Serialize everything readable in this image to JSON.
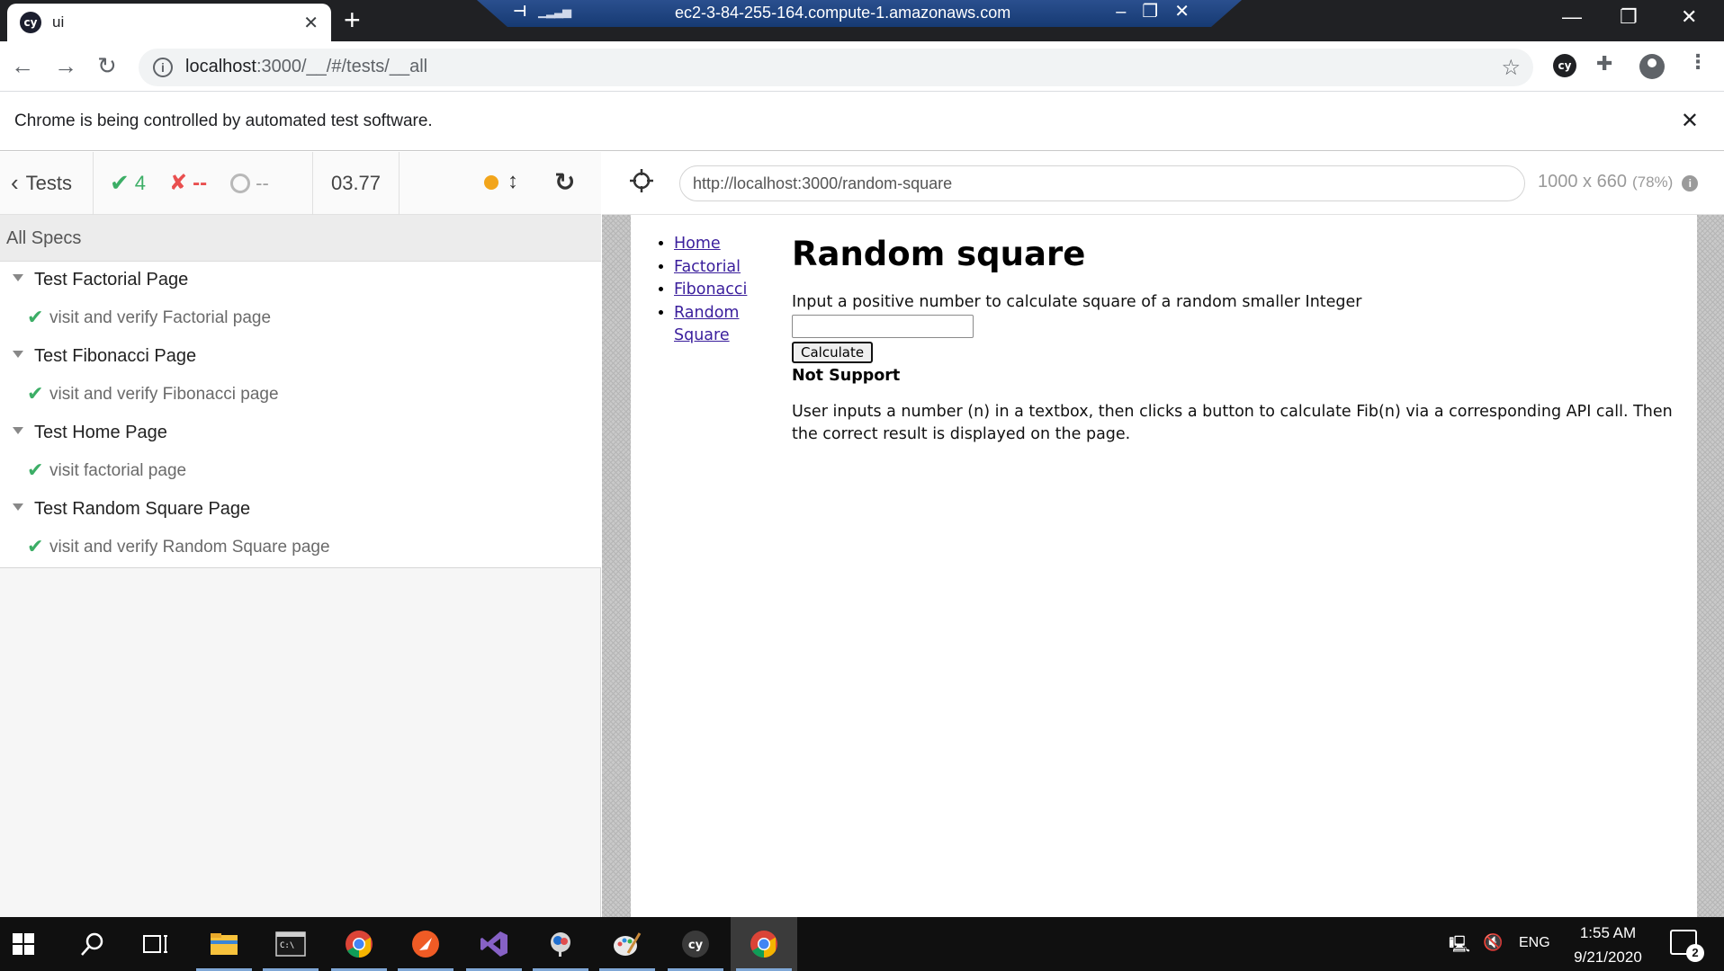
{
  "browser": {
    "tab_title": "ui",
    "tab_favicon": "cy",
    "remote_session_title": "ec2-3-84-255-164.compute-1.amazonaws.com",
    "url_host": "localhost",
    "url_rest": ":3000/__/#/tests/__all",
    "infobar_message": "Chrome is being controlled by automated test software.",
    "extension_label": "cy"
  },
  "reporter": {
    "tests_label": "Tests",
    "passed_count": "4",
    "failed_count": "--",
    "pending_count": "--",
    "duration": "03.77",
    "all_specs_label": "All Specs",
    "suites": [
      {
        "title": "Test Factorial Page",
        "tests": [
          "visit and verify Factorial page"
        ]
      },
      {
        "title": "Test Fibonacci Page",
        "tests": [
          "visit and verify Fibonacci page"
        ]
      },
      {
        "title": "Test Home Page",
        "tests": [
          "visit factorial page"
        ]
      },
      {
        "title": "Test Random Square Page",
        "tests": [
          "visit and verify Random Square page"
        ]
      }
    ],
    "status_colors": {
      "passed": "#3cae66",
      "failed": "#e94f4f",
      "running": "#f2a51b"
    }
  },
  "aut": {
    "url": "http://localhost:3000/random-square",
    "viewport": "1000 x 660",
    "scale": "(78%)",
    "nav_links": [
      "Home",
      "Factorial",
      "Fibonacci",
      "Random",
      "Square"
    ],
    "heading": "Random square",
    "prompt": "Input a positive number to calculate square of a random smaller Integer",
    "input_value": "",
    "button_label": "Calculate",
    "result": "Not Support",
    "description": "User inputs a number (n) in a textbox, then clicks a button to calculate Fib(n) via a corresponding API call. Then the correct result is displayed on the page."
  },
  "taskbar": {
    "language": "ENG",
    "time": "1:55 AM",
    "date": "9/21/2020",
    "notification_count": "2",
    "cypress_label": "cy",
    "apps": [
      "start-icon",
      "search-icon",
      "task-view-icon",
      "file-explorer-icon",
      "terminal-icon",
      "chrome-icon",
      "postman-icon",
      "visual-studio-icon",
      "app-icon",
      "paint-icon",
      "cypress-icon",
      "chrome-active-icon"
    ]
  }
}
